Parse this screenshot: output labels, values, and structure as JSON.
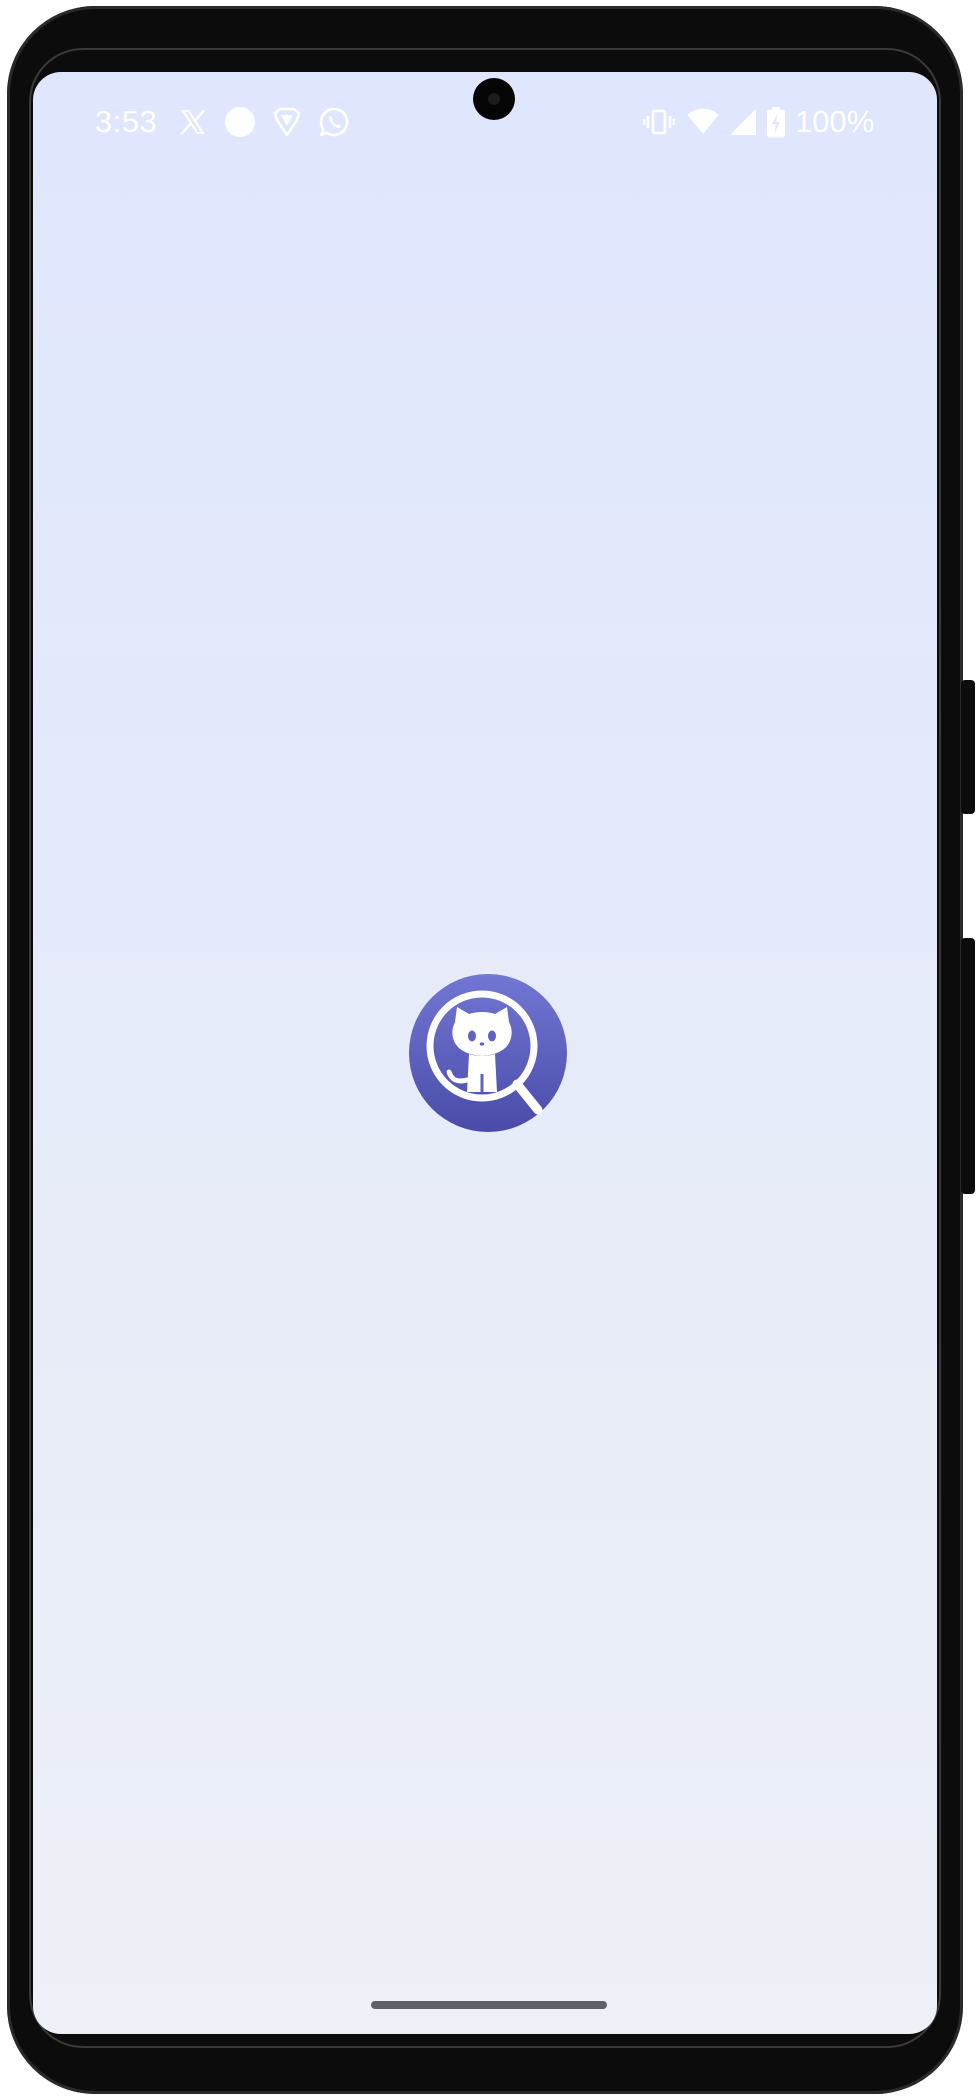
{
  "status_bar": {
    "time": "3:53",
    "battery_percent": "100%",
    "left_icons": [
      "x-app-icon",
      "circle-notification-icon",
      "brave-browser-icon",
      "whatsapp-icon"
    ],
    "right_icons": [
      "vibrate-icon",
      "wifi-icon",
      "cell-signal-icon",
      "battery-icon"
    ]
  },
  "splash": {
    "logo_icon": "octocat-magnifier-icon",
    "logo_colors": [
      "#7277d3",
      "#4a4ba8"
    ]
  },
  "navigation": {
    "home_indicator": "gesture-nav-bar"
  }
}
